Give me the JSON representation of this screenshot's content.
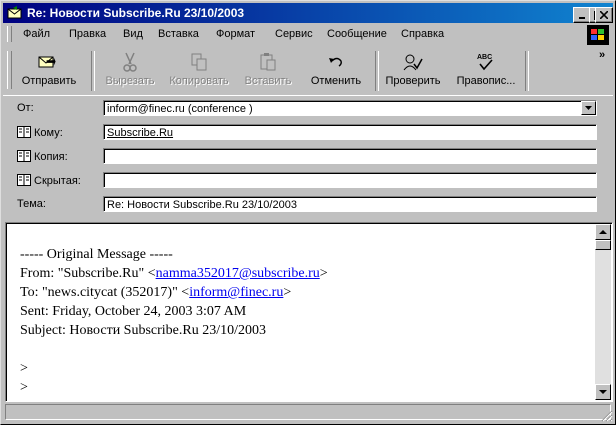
{
  "window": {
    "title": "Re: Новости Subscribe.Ru 23/10/2003"
  },
  "menu": [
    {
      "label": "Файл"
    },
    {
      "label": "Правка"
    },
    {
      "label": "Вид"
    },
    {
      "label": "Вставка"
    },
    {
      "label": "Формат"
    },
    {
      "label": "Сервис"
    },
    {
      "label": "Сообщение"
    },
    {
      "label": "Справка"
    }
  ],
  "toolbar": {
    "send": "Отправить",
    "cut": "Вырезать",
    "copy": "Копировать",
    "paste": "Вставить",
    "undo": "Отменить",
    "check": "Проверить",
    "spelling": "Правопис...",
    "more": "»"
  },
  "header": {
    "from_label": "От:",
    "from_value": "inform@finec.ru    (conference )",
    "to_label": "Кому:",
    "to_value": "Subscribe.Ru",
    "cc_label": "Копия:",
    "cc_value": "",
    "bcc_label": "Скрытая:",
    "bcc_value": "",
    "subject_label": "Тема:",
    "subject_value": "Re: Новости Subscribe.Ru 23/10/2003"
  },
  "message": {
    "line1": "----- Original Message -----",
    "from_prefix": "From: \"Subscribe.Ru\" <",
    "from_email": "namma352017@subscribe.ru",
    "from_suffix": ">",
    "to_prefix": "To: \"news.citycat (352017)\" <",
    "to_email": "inform@finec.ru",
    "to_suffix": ">",
    "sent": "Sent: Friday, October 24, 2003 3:07 AM",
    "subject": "Subject: Новости Subscribe.Ru 23/10/2003",
    "quote1": ">",
    "quote2": ">"
  }
}
